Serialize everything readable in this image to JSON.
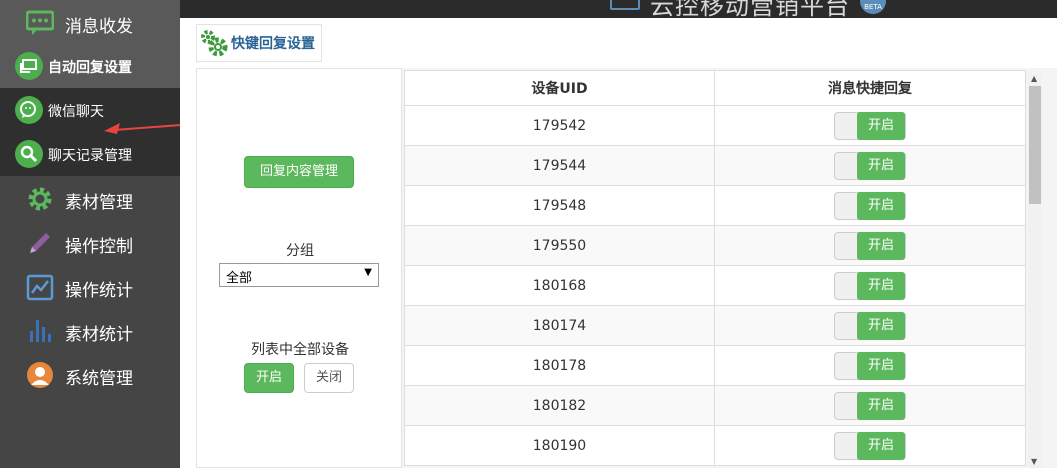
{
  "header": {
    "title": "云控移动营销平台",
    "badge": "BETA"
  },
  "sidebar": {
    "items": [
      {
        "label": "消息收发",
        "icon": "chat-icon",
        "type": "main"
      },
      {
        "label": "自动回复设置",
        "icon": "auto-reply-icon",
        "type": "sub"
      },
      {
        "label": "微信聊天",
        "icon": "wechat-icon",
        "type": "sub"
      },
      {
        "label": "聊天记录管理",
        "icon": "search-icon",
        "type": "sub"
      },
      {
        "label": "素材管理",
        "icon": "gear-icon",
        "type": "main"
      },
      {
        "label": "操作控制",
        "icon": "pencil-icon",
        "type": "main"
      },
      {
        "label": "操作统计",
        "icon": "chart-icon",
        "type": "main"
      },
      {
        "label": "素材统计",
        "icon": "bar-chart-icon",
        "type": "main"
      },
      {
        "label": "系统管理",
        "icon": "user-icon",
        "type": "main"
      }
    ]
  },
  "tab": {
    "label": "快键回复设置"
  },
  "left_panel": {
    "reply_content_button": "回复内容管理",
    "group_label": "分组",
    "group_select": "全部",
    "all_devices_label": "列表中全部设备",
    "on_button": "开启",
    "off_button": "关闭"
  },
  "table": {
    "headers": [
      "设备UID",
      "消息快捷回复"
    ],
    "rows": [
      {
        "uid": "179542",
        "toggle": "开启"
      },
      {
        "uid": "179544",
        "toggle": "开启"
      },
      {
        "uid": "179548",
        "toggle": "开启"
      },
      {
        "uid": "179550",
        "toggle": "开启"
      },
      {
        "uid": "180168",
        "toggle": "开启"
      },
      {
        "uid": "180174",
        "toggle": "开启"
      },
      {
        "uid": "180178",
        "toggle": "开启"
      },
      {
        "uid": "180182",
        "toggle": "开启"
      },
      {
        "uid": "180190",
        "toggle": "开启"
      }
    ]
  },
  "colors": {
    "accent": "#5cb85c",
    "link": "#2a6496",
    "sidebar": "#454545",
    "annotation": "#e8453c"
  }
}
